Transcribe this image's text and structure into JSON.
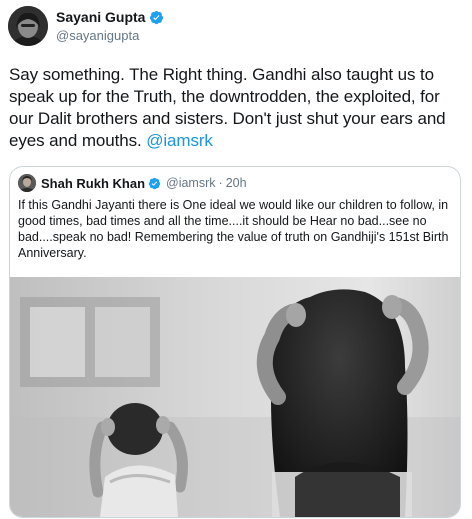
{
  "tweet": {
    "author_name": "Sayani Gupta",
    "author_handle": "@sayanigupta",
    "text": "Say something. The Right thing. Gandhi also taught us to speak up for the Truth, the downtrodden, the exploited, for our Dalit brothers and sisters. Don't just shut your ears and eyes and mouths. ",
    "mention": "@iamsrk"
  },
  "quoted": {
    "author_name": "Shah Rukh Khan",
    "author_handle": "@iamsrk",
    "separator": "·",
    "time": "20h",
    "text": "If this Gandhi Jayanti there is One ideal we would like our children to follow, in good times, bad times and all the time....it should be Hear no bad...see no bad....speak no bad!  Remembering the value of truth on Gandhiji's 151st Birth Anniversary."
  },
  "colors": {
    "link": "#1b95e0",
    "verified": "#1da1f2",
    "secondary_text": "#657786",
    "border": "#ccd6dd"
  },
  "icons": {
    "verified": "verified-badge-icon"
  }
}
